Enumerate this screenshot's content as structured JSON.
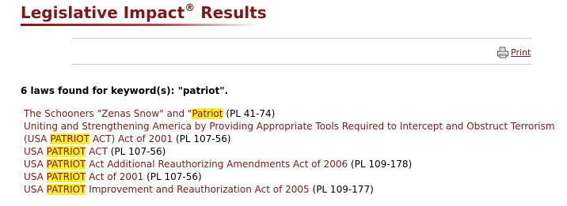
{
  "header": {
    "title": "Legislative Impact",
    "registered": "®",
    "title_suffix": "Results"
  },
  "toolbar": {
    "print_label": "Print"
  },
  "summary": "6 laws found for keyword(s): \"patriot\".",
  "colors": {
    "accent": "#7a1a1a",
    "highlight": "#ffee33"
  },
  "results": [
    {
      "parts": [
        {
          "text": "The Schooners \"Zenas Snow\" and \"",
          "hl": false
        },
        {
          "text": "Patriot",
          "hl": true
        }
      ],
      "pl": "(PL 41-74)"
    },
    {
      "parts": [
        {
          "text": "Uniting and Strengthening America by Providing Appropriate Tools Required to Intercept and Obstruct Terrorism (USA ",
          "hl": false
        },
        {
          "text": "PATRIOT",
          "hl": true
        },
        {
          "text": " ACT) Act of 2001",
          "hl": false
        }
      ],
      "pl": "(PL 107-56)"
    },
    {
      "parts": [
        {
          "text": "USA ",
          "hl": false
        },
        {
          "text": "PATRIOT",
          "hl": true
        },
        {
          "text": " ACT",
          "hl": false
        }
      ],
      "pl": "(PL 107-56)"
    },
    {
      "parts": [
        {
          "text": "USA ",
          "hl": false
        },
        {
          "text": "PATRIOT",
          "hl": true
        },
        {
          "text": " Act Additional Reauthorizing Amendments Act of 2006",
          "hl": false
        }
      ],
      "pl": "(PL 109-178)"
    },
    {
      "parts": [
        {
          "text": "USA ",
          "hl": false
        },
        {
          "text": "PATRIOT",
          "hl": true
        },
        {
          "text": " Act of 2001",
          "hl": false
        }
      ],
      "pl": "(PL 107-56)"
    },
    {
      "parts": [
        {
          "text": "USA ",
          "hl": false
        },
        {
          "text": "PATRIOT",
          "hl": true
        },
        {
          "text": " Improvement and Reauthorization Act of 2005",
          "hl": false
        }
      ],
      "pl": "(PL 109-177)"
    }
  ]
}
